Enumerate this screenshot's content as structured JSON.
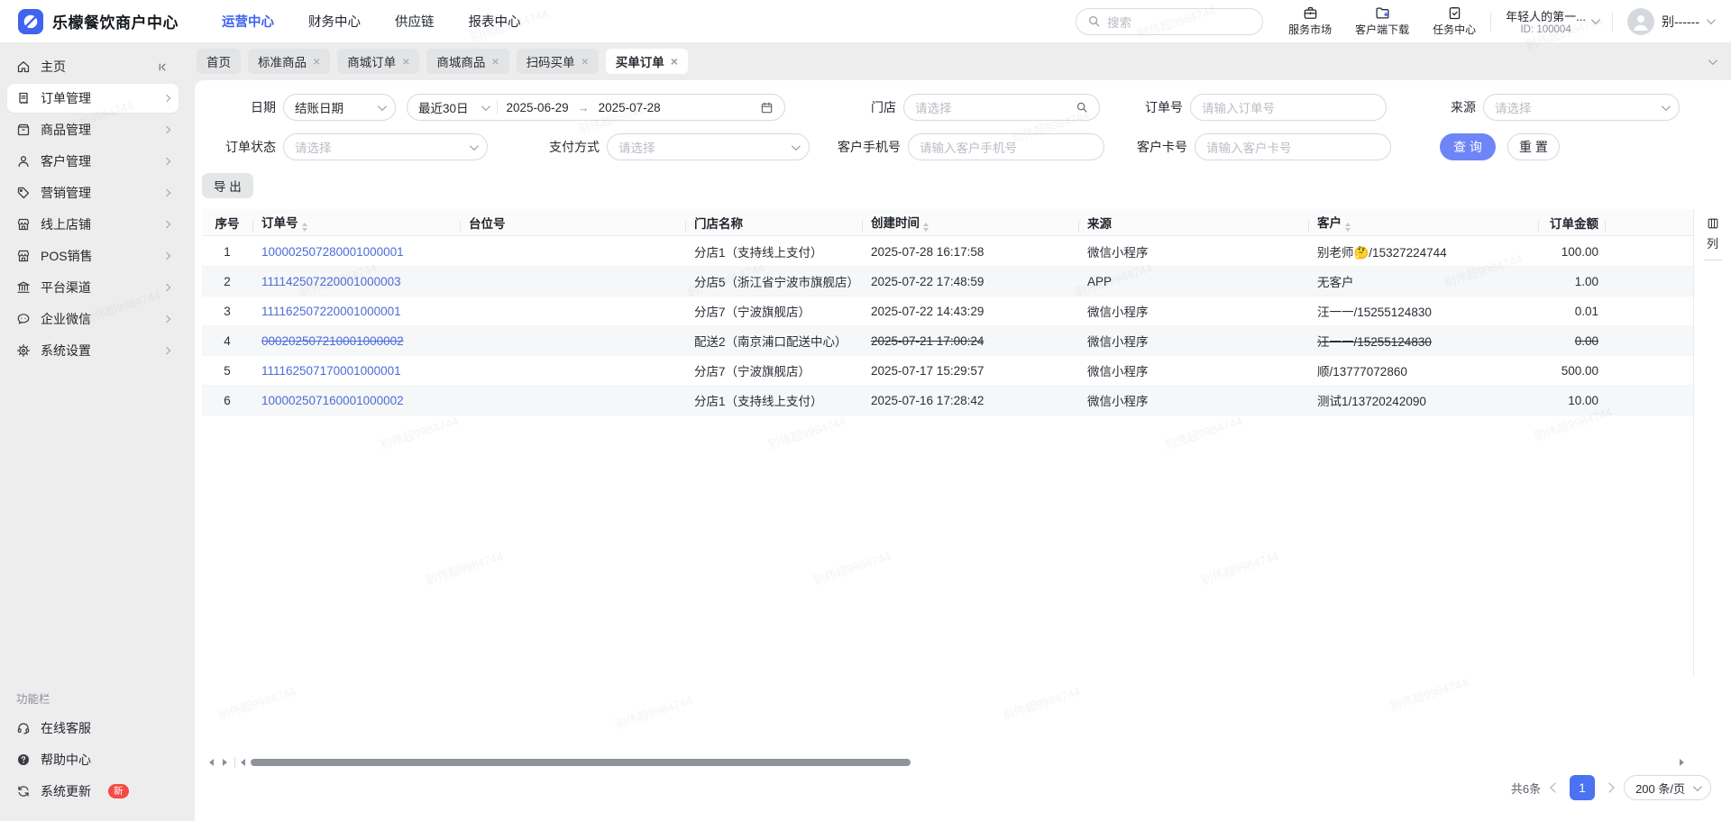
{
  "watermark": "别伟超9984744",
  "header": {
    "brand": "乐檬餐饮商户中心",
    "nav": [
      {
        "label": "运营中心",
        "active": true
      },
      {
        "label": "财务中心",
        "active": false
      },
      {
        "label": "供应链",
        "active": false
      },
      {
        "label": "报表中心",
        "active": false
      }
    ],
    "search_placeholder": "搜索",
    "quick_links": [
      {
        "label": "服务市场",
        "icon": "briefcase-icon"
      },
      {
        "label": "客户端下载",
        "icon": "folder-download-icon"
      },
      {
        "label": "任务中心",
        "icon": "clipboard-check-icon"
      }
    ],
    "account_name": "年轻人的第一...",
    "account_id": "ID: 100004",
    "user_short": "别------"
  },
  "sidebar": {
    "items": [
      {
        "label": "主页",
        "icon": "home-icon",
        "selected": false
      },
      {
        "label": "订单管理",
        "icon": "order-icon",
        "selected": true
      },
      {
        "label": "商品管理",
        "icon": "goods-icon",
        "selected": false
      },
      {
        "label": "客户管理",
        "icon": "customer-icon",
        "selected": false
      },
      {
        "label": "营销管理",
        "icon": "tag-icon",
        "selected": false
      },
      {
        "label": "线上店铺",
        "icon": "store-icon",
        "selected": false
      },
      {
        "label": "POS销售",
        "icon": "store-icon",
        "selected": false
      },
      {
        "label": "平台渠道",
        "icon": "bank-icon",
        "selected": false
      },
      {
        "label": "企业微信",
        "icon": "wechat-icon",
        "selected": false
      },
      {
        "label": "系统设置",
        "icon": "gear-icon",
        "selected": false
      }
    ],
    "footer_label": "功能栏",
    "footer_items": [
      {
        "label": "在线客服",
        "icon": "headset-icon"
      },
      {
        "label": "帮助中心",
        "icon": "help-icon"
      },
      {
        "label": "系统更新",
        "icon": "update-icon",
        "badge": "新"
      }
    ]
  },
  "tabs": [
    {
      "label": "首页",
      "closable": false,
      "active": false
    },
    {
      "label": "标准商品",
      "closable": true,
      "active": false
    },
    {
      "label": "商城订单",
      "closable": true,
      "active": false
    },
    {
      "label": "商城商品",
      "closable": true,
      "active": false
    },
    {
      "label": "扫码买单",
      "closable": true,
      "active": false
    },
    {
      "label": "买单订单",
      "closable": true,
      "active": true
    }
  ],
  "filters": {
    "date_label": "日期",
    "date_type_value": "结账日期",
    "date_range_value": "最近30日",
    "date_start": "2025-06-29",
    "date_end": "2025-07-28",
    "store_label": "门店",
    "store_placeholder": "请选择",
    "order_label": "订单号",
    "order_placeholder": "请输入订单号",
    "source_label": "来源",
    "source_placeholder": "请选择",
    "status_label": "订单状态",
    "status_placeholder": "请选择",
    "pay_label": "支付方式",
    "pay_placeholder": "请选择",
    "phone_label": "客户手机号",
    "phone_placeholder": "请输入客户手机号",
    "card_label": "客户卡号",
    "card_placeholder": "请输入客户卡号",
    "search_button": "查 询",
    "reset_button": "重 置"
  },
  "toolbar": {
    "export_button": "导 出"
  },
  "table": {
    "columns": [
      {
        "label": "序号",
        "sortable": false
      },
      {
        "label": "订单号",
        "sortable": true
      },
      {
        "label": "台位号",
        "sortable": false
      },
      {
        "label": "门店名称",
        "sortable": false
      },
      {
        "label": "创建时间",
        "sortable": true
      },
      {
        "label": "来源",
        "sortable": false
      },
      {
        "label": "客户",
        "sortable": true
      },
      {
        "label": "订单金额",
        "sortable": false
      }
    ],
    "column_tool_label": "列",
    "rows": [
      {
        "no": "1",
        "order_no": "100002507280001000001",
        "table_no": "",
        "store": "分店1（支持线上支付）",
        "created": "2025-07-28 16:17:58",
        "source": "微信小程序",
        "customer": "别老师🤔/15327224744",
        "amount": "100.00",
        "struck": false
      },
      {
        "no": "2",
        "order_no": "111142507220001000003",
        "table_no": "",
        "store": "分店5（浙江省宁波市旗舰店）",
        "created": "2025-07-22 17:48:59",
        "source": "APP",
        "customer": "无客户",
        "amount": "1.00",
        "struck": false
      },
      {
        "no": "3",
        "order_no": "111162507220001000001",
        "table_no": "",
        "store": "分店7（宁波旗舰店）",
        "created": "2025-07-22 14:43:29",
        "source": "微信小程序",
        "customer": "汪一一/15255124830",
        "amount": "0.01",
        "struck": false
      },
      {
        "no": "4",
        "order_no": "000202507210001000002",
        "table_no": "",
        "store": "配送2（南京浦口配送中心）",
        "created": "2025-07-21 17:00:24",
        "source": "微信小程序",
        "customer": "汪一一/15255124830",
        "amount": "0.00",
        "struck": true
      },
      {
        "no": "5",
        "order_no": "111162507170001000001",
        "table_no": "",
        "store": "分店7（宁波旗舰店）",
        "created": "2025-07-17 15:29:57",
        "source": "微信小程序",
        "customer": "顺/13777072860",
        "amount": "500.00",
        "struck": false
      },
      {
        "no": "6",
        "order_no": "100002507160001000002",
        "table_no": "",
        "store": "分店1（支持线上支付）",
        "created": "2025-07-16 17:28:42",
        "source": "微信小程序",
        "customer": "测试1/13720242090",
        "amount": "10.00",
        "struck": false
      }
    ]
  },
  "pagination": {
    "total": "共6条",
    "current_page": "1",
    "page_size": "200 条/页"
  }
}
